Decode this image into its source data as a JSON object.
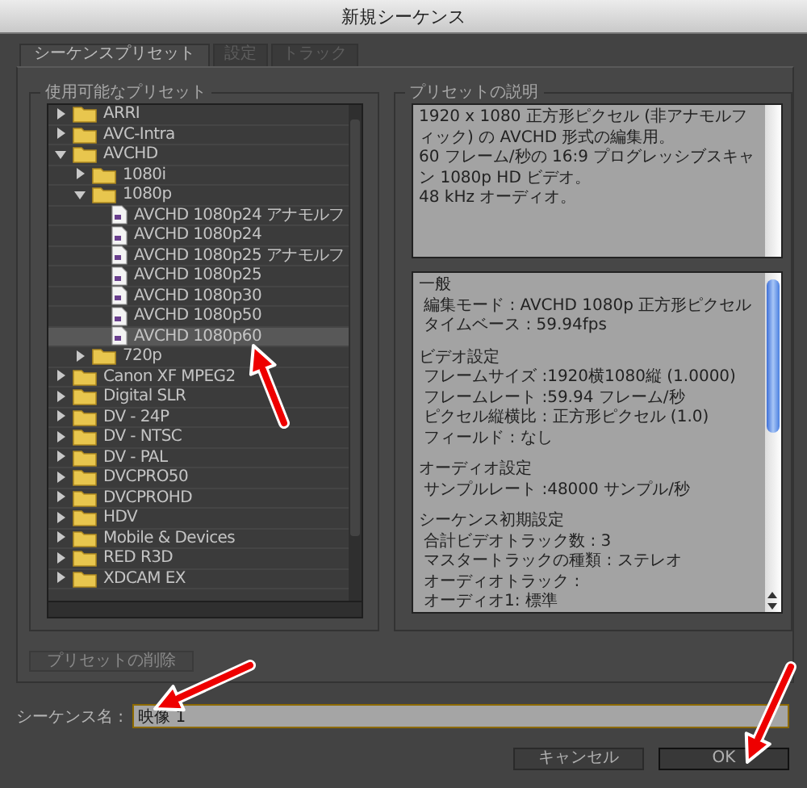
{
  "window": {
    "title": "新規シーケンス"
  },
  "tabs": [
    {
      "label": "シーケンスプリセット",
      "selected": true
    },
    {
      "label": "設定",
      "selected": false
    },
    {
      "label": "トラック",
      "selected": false
    }
  ],
  "presets": {
    "title": "使用可能なプリセット",
    "items": [
      {
        "kind": "folder",
        "label": "ARRI",
        "expanded": false,
        "selected": false
      },
      {
        "kind": "folder",
        "label": "AVC-Intra",
        "expanded": false,
        "selected": false
      },
      {
        "kind": "folder",
        "label": "AVCHD",
        "expanded": true,
        "selected": false,
        "children": [
          {
            "kind": "folder",
            "label": "1080i",
            "expanded": false,
            "selected": false
          },
          {
            "kind": "folder",
            "label": "1080p",
            "expanded": true,
            "selected": false,
            "children": [
              {
                "kind": "preset",
                "label": "AVCHD 1080p24 アナモルフ",
                "selected": false
              },
              {
                "kind": "preset",
                "label": "AVCHD 1080p24",
                "selected": false
              },
              {
                "kind": "preset",
                "label": "AVCHD 1080p25 アナモルフ",
                "selected": false
              },
              {
                "kind": "preset",
                "label": "AVCHD 1080p25",
                "selected": false
              },
              {
                "kind": "preset",
                "label": "AVCHD 1080p30",
                "selected": false
              },
              {
                "kind": "preset",
                "label": "AVCHD 1080p50",
                "selected": false
              },
              {
                "kind": "preset",
                "label": "AVCHD 1080p60",
                "selected": true
              }
            ]
          },
          {
            "kind": "folder",
            "label": "720p",
            "expanded": false,
            "selected": false
          }
        ]
      },
      {
        "kind": "folder",
        "label": "Canon XF MPEG2",
        "expanded": false,
        "selected": false
      },
      {
        "kind": "folder",
        "label": "Digital SLR",
        "expanded": false,
        "selected": false
      },
      {
        "kind": "folder",
        "label": "DV - 24P",
        "expanded": false,
        "selected": false
      },
      {
        "kind": "folder",
        "label": "DV - NTSC",
        "expanded": false,
        "selected": false
      },
      {
        "kind": "folder",
        "label": "DV - PAL",
        "expanded": false,
        "selected": false
      },
      {
        "kind": "folder",
        "label": "DVCPRO50",
        "expanded": false,
        "selected": false
      },
      {
        "kind": "folder",
        "label": "DVCPROHD",
        "expanded": false,
        "selected": false
      },
      {
        "kind": "folder",
        "label": "HDV",
        "expanded": false,
        "selected": false
      },
      {
        "kind": "folder",
        "label": "Mobile & Devices",
        "expanded": false,
        "selected": false
      },
      {
        "kind": "folder",
        "label": "RED R3D",
        "expanded": false,
        "selected": false
      },
      {
        "kind": "folder",
        "label": "XDCAM EX",
        "expanded": false,
        "selected": false
      }
    ]
  },
  "delete_button": {
    "label": "プリセットの削除",
    "disabled": true
  },
  "description": {
    "title": "プリセットの説明",
    "paragraphs": [
      "1920 x 1080 正方形ピクセル (非アナモルフィック) の AVCHD 形式の編集用。",
      "60 フレーム/秒の 16:9 プログレッシブスキャン 1080p HD ビデオ。",
      "48 kHz オーディオ。"
    ],
    "details": [
      {
        "heading": "一般",
        "lines": [
          "編集モード : AVCHD 1080p 正方形ピクセル",
          "タイムベース : 59.94fps"
        ]
      },
      {
        "heading": "ビデオ設定",
        "lines": [
          "フレームサイズ :1920横1080縦 (1.0000)",
          "フレームレート :59.94 フレーム/秒",
          "ピクセル縦横比 : 正方形ピクセル (1.0)",
          "フィールド : なし"
        ]
      },
      {
        "heading": "オーディオ設定",
        "lines": [
          "サンプルレート :48000 サンプル/秒"
        ]
      },
      {
        "heading": "シーケンス初期設定",
        "lines": [
          "合計ビデオトラック数 : 3",
          "マスタートラックの種類 : ステレオ",
          "オーディオトラック :",
          "オーディオ1: 標準"
        ]
      }
    ]
  },
  "sequence_name": {
    "label": "シーケンス名 :",
    "value": "映像 1"
  },
  "buttons": [
    {
      "label": "キャンセル",
      "default": false
    },
    {
      "label": "OK",
      "default": true
    }
  ],
  "annotation_arrows": [
    {
      "kind": "arrow"
    },
    {
      "kind": "arrow"
    },
    {
      "kind": "arrow"
    }
  ]
}
